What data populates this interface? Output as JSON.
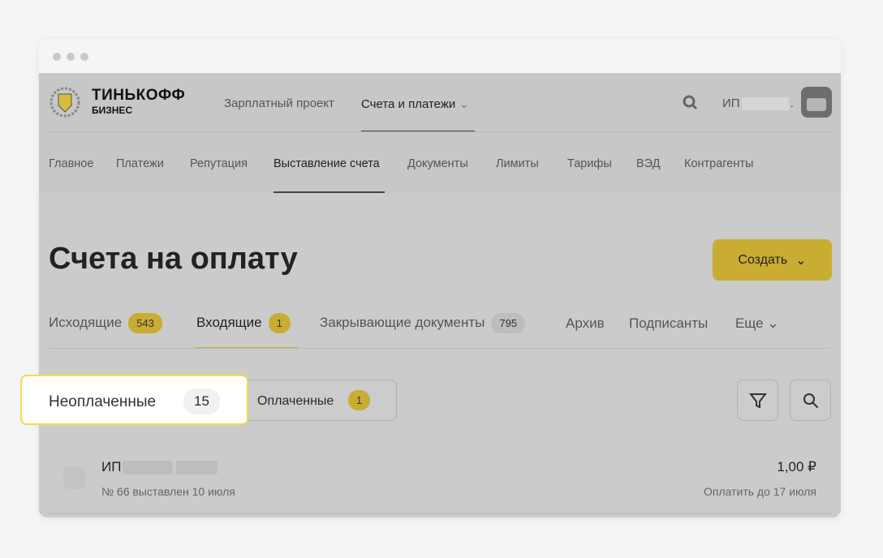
{
  "logo": {
    "line1": "ТИНЬКОФФ",
    "line2": "БИЗНЕС"
  },
  "topnav": [
    {
      "label": "Зарплатный проект"
    },
    {
      "label": "Счета и платежи"
    }
  ],
  "user": {
    "name": "ИП",
    "suffix": "."
  },
  "subnav": [
    "Главное",
    "Платежи",
    "Репутация",
    "Выставление счета",
    "Документы",
    "Лимиты",
    "Тарифы",
    "ВЭД",
    "Контрагенты"
  ],
  "page": {
    "title": "Счета на оплату",
    "create_label": "Создать"
  },
  "tabs": [
    {
      "label": "Исходящие",
      "count": "543"
    },
    {
      "label": "Входящие",
      "count": "1"
    },
    {
      "label": "Закрывающие документы",
      "count": "795"
    },
    {
      "label": "Архив"
    },
    {
      "label": "Подписанты"
    },
    {
      "label": "Еще"
    }
  ],
  "filters": [
    {
      "label": "Неоплаченные",
      "count": "15"
    },
    {
      "label": "Оплаченные",
      "count": "1"
    }
  ],
  "invoice": {
    "name": "ИП",
    "subtitle": "№ 66 выставлен 10 июля",
    "amount": "1,00 ₽",
    "due": "Оплатить до 17 июля"
  },
  "colors": {
    "accent": "#c9ad33",
    "highlight_border": "#f5dc4a"
  }
}
